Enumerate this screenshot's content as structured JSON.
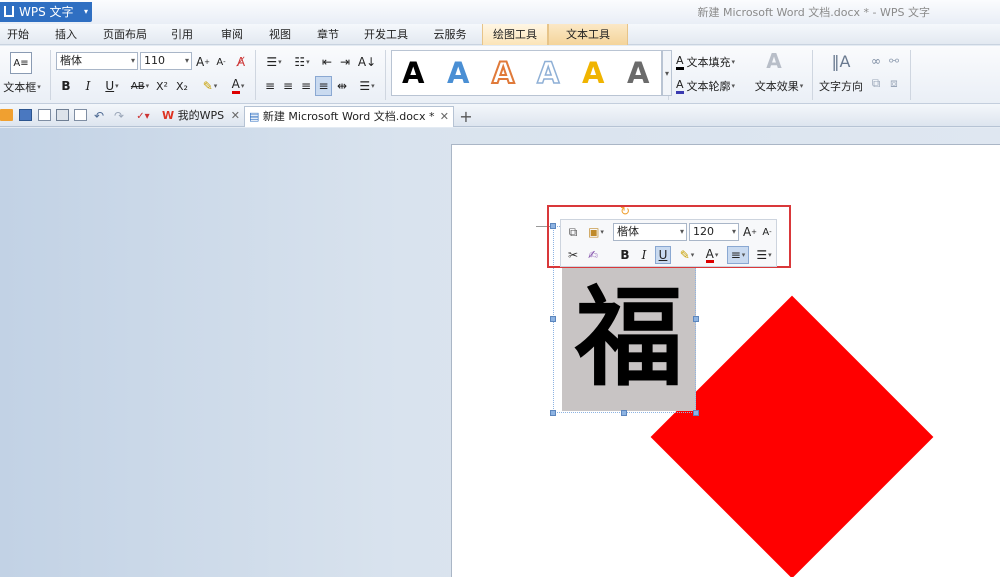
{
  "app": {
    "button_label": "WPS 文字",
    "window_title": "新建 Microsoft Word 文档.docx * - WPS 文字"
  },
  "menu": {
    "tabs": [
      "开始",
      "插入",
      "页面布局",
      "引用",
      "审阅",
      "视图",
      "章节",
      "开发工具",
      "云服务",
      "绘图工具",
      "文本工具"
    ]
  },
  "ribbon": {
    "text_box_label": "文本框",
    "font": "楷体",
    "size": "110",
    "bold": "B",
    "italic": "I",
    "underline": "U",
    "strike": "AB",
    "superscript": "X²",
    "subscript": "X₂",
    "font_color_glyph": "A",
    "grow_glyph": "A",
    "shrink_glyph": "A",
    "text_fill": "文本填充",
    "text_outline": "文本轮廓",
    "text_effect": "文本效果",
    "text_direction": "文字方向",
    "style_glyph": "A"
  },
  "styles": {
    "letter": "A",
    "colors": [
      "#000000",
      "#4a8fd4",
      "#e07a3a",
      "#8fb0d6",
      "#f0b400",
      "#6b6b6b"
    ]
  },
  "tabs": [
    {
      "label": "我的WPS",
      "close": "✕"
    },
    {
      "label": "新建 Microsoft Word 文档.docx *",
      "close": "✕"
    }
  ],
  "new_tab": "+",
  "document": {
    "character": "福"
  },
  "mini_toolbar": {
    "font": "楷体",
    "size": "120",
    "bold": "B",
    "italic": "I",
    "underline": "U",
    "color_glyph": "A",
    "grow": "A",
    "shrink": "A"
  },
  "colors": {
    "accent": "#2f6fc2",
    "diamond": "#ff0000",
    "highlight_box": "#d9383a"
  }
}
